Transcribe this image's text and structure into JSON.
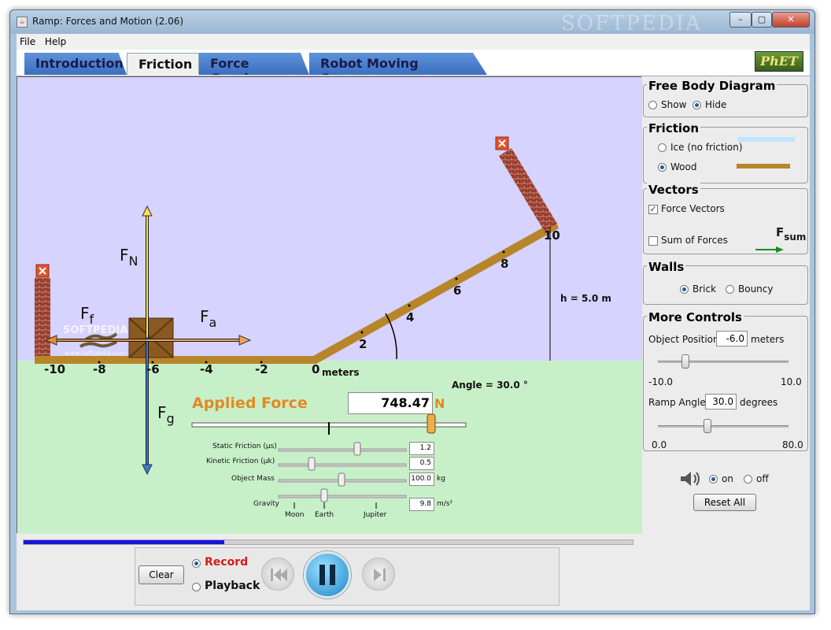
{
  "window": {
    "title": "Ramp: Forces and Motion (2.06)",
    "watermark": "SOFTPEDIA",
    "buttons": [
      "–",
      "▢",
      "✕"
    ]
  },
  "menu": [
    "File",
    "Help"
  ],
  "tabs": [
    {
      "label": "Introduction",
      "active": false
    },
    {
      "label": "Friction",
      "active": true
    },
    {
      "label": "Force Graphs",
      "active": false
    },
    {
      "label": "Robot Moving Company",
      "active": false
    }
  ],
  "logo": "PhET",
  "sim": {
    "sky_color": "#d6d3ff",
    "ground_color": "#c8f0c8",
    "ramp_color": "#b8862a",
    "position_ticks": [
      "-10",
      "-8",
      "-6",
      "-4",
      "-2",
      "0",
      "2",
      "4",
      "6",
      "8",
      "10"
    ],
    "meters_label": "meters",
    "height_label": "h = 5.0 m",
    "angle_label": "Angle = 30.0 °",
    "vectors": {
      "normal": "F",
      "normal_sub": "N",
      "friction": "F",
      "friction_sub": "f",
      "applied": "F",
      "applied_sub": "a",
      "gravity": "F",
      "gravity_sub": "g"
    },
    "applied_force": {
      "label": "Applied Force",
      "value": "748.47",
      "unit": "N"
    },
    "params": [
      {
        "label": "Static Friction (μs)",
        "value": "1.2"
      },
      {
        "label": "Kinetic Friction (μk)",
        "value": "0.5"
      },
      {
        "label": "Object Mass",
        "value": "100.0",
        "unit": "kg"
      },
      {
        "label": "Gravity",
        "value": "9.8",
        "unit": "m/s²"
      }
    ],
    "gravity_marks": [
      "Moon",
      "Earth",
      "Jupiter"
    ],
    "site_watermark": "SOFTPEDIA",
    "site_url": "www.softpedia.com"
  },
  "panels": {
    "free_body": {
      "title": "Free Body Diagram",
      "show": "Show",
      "hide": "Hide",
      "selected": "Hide"
    },
    "friction": {
      "title": "Friction",
      "ice": "Ice (no friction)",
      "wood": "Wood",
      "selected": "Wood",
      "ice_color": "#bfe4ff",
      "wood_color": "#b8862a"
    },
    "vectors": {
      "title": "Vectors",
      "force_vectors": "Force Vectors",
      "force_checked": true,
      "sum_of_forces": "Sum of Forces",
      "sum_checked": false,
      "fsum": "F",
      "fsum_sub": "sum"
    },
    "walls": {
      "title": "Walls",
      "brick": "Brick",
      "bouncy": "Bouncy",
      "selected": "Brick"
    },
    "more": {
      "title": "More Controls",
      "position_label": "Object Position",
      "position_value": "-6.0",
      "position_unit": "meters",
      "pos_min": "-10.0",
      "pos_max": "10.0",
      "angle_label": "Ramp Angle",
      "angle_value": "30.0",
      "angle_unit": "degrees",
      "ang_min": "0.0",
      "ang_max": "80.0"
    },
    "sound": {
      "on": "on",
      "off": "off",
      "selected": "on"
    },
    "reset": "Reset All"
  },
  "playback": {
    "clear": "Clear",
    "record": "Record",
    "playback": "Playback",
    "selected": "Record",
    "progress": 0.33
  }
}
